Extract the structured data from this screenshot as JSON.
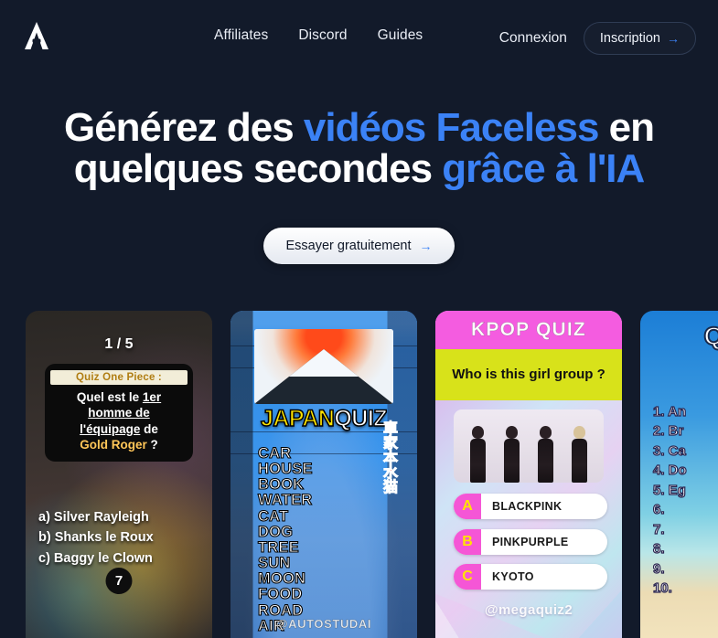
{
  "brand": {
    "logo_alt": "A"
  },
  "nav": {
    "links": [
      {
        "label": "Affiliates"
      },
      {
        "label": "Discord"
      },
      {
        "label": "Guides"
      }
    ],
    "login_label": "Connexion",
    "signup_label": "Inscription",
    "signup_arrow": "→"
  },
  "hero": {
    "line1_a": "Générez des ",
    "line1_hl": "vidéos Faceless",
    "line1_b": " en",
    "line2_a": "quelques secondes ",
    "line2_hl": "grâce à l'IA",
    "cta_label": "Essayer gratuitement",
    "cta_arrow": "→",
    "accent_color": "#3b82f6"
  },
  "cards": [
    {
      "id": "one-piece-quiz",
      "counter": "1 / 5",
      "quiz_title": "Quiz One Piece :",
      "question_part1": "Quel est le ",
      "question_underline1": "1er",
      "question_underline2": "homme de",
      "question_underline3": "l'équipage",
      "question_part2": " de",
      "question_gold": "Gold Roger",
      "question_end": "?",
      "answers": [
        "a) Silver Rayleigh",
        "b) Shanks le Roux",
        "c) Baggy le Clown"
      ],
      "timer": "7"
    },
    {
      "id": "japan-quiz",
      "title_yellow": "JAPAN",
      "title_white": "QUIZ",
      "words": [
        "CAR",
        "HOUSE",
        "BOOK",
        "WATER",
        "CAT",
        "DOG",
        "TREE",
        "SUN",
        "MOON",
        "FOOD",
        "ROAD",
        "AIR"
      ],
      "kanji": "車家本水猫",
      "watermark": "@AUTOSTUDAI"
    },
    {
      "id": "kpop-quiz",
      "header": "KPOP QUIZ",
      "question": "Who is this girl group ?",
      "options": [
        {
          "letter": "A",
          "text": "BLACKPINK"
        },
        {
          "letter": "B",
          "text": "PINKPURPLE"
        },
        {
          "letter": "C",
          "text": "KYOTO"
        }
      ],
      "watermark": "@megaquiz2",
      "header_color": "#f45ce0",
      "question_bg": "#d8e21a"
    },
    {
      "id": "beach-quiz",
      "title": "QUIZ",
      "items": [
        "1. An",
        "2. Br",
        "3. Ca",
        "4. Do",
        "5. Eg",
        "6.",
        "7.",
        "8.",
        "9.",
        "10."
      ]
    }
  ]
}
